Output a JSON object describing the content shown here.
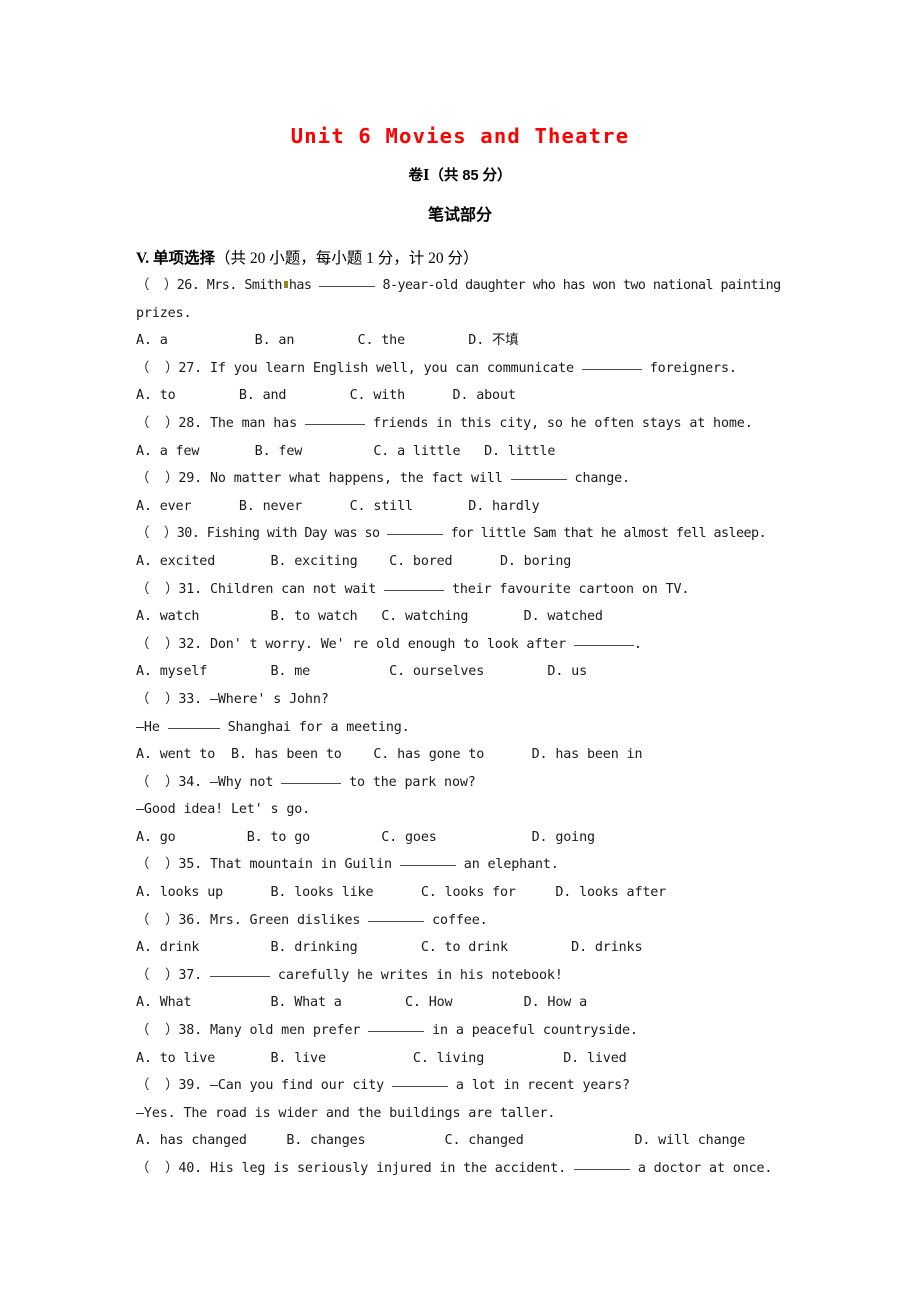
{
  "document": {
    "title": "Unit 6 Movies and Theatre",
    "volume_label": "卷",
    "volume_number": "I",
    "volume_score": "（共 85 分）",
    "section_title": "笔试部分",
    "part": {
      "roman": "V.",
      "name": "单项选择",
      "meta": "（共 20 小题，每小题 1 分，计 20 分）"
    },
    "title_color": "#ff0000",
    "text_color": "#1a1a1a"
  },
  "questions": [
    {
      "number": "26",
      "marker": "（  ）",
      "stem_1": "26. Mrs. Smith",
      "stem_2": "has",
      "stem_3": "8-year-old daughter who has won two national painting",
      "stem_wrap": "prizes.",
      "options": "A. a           B. an        C. the        D. 不填",
      "options_parts": [
        "A. a",
        "B. an",
        "C. the",
        "D. 不填"
      ]
    },
    {
      "number": "27",
      "marker": "（  ）",
      "stem": "27. If you learn English well, you can communicate",
      "stem_tail": "foreigners.",
      "options": "A. to        B. and        C. with      D. about",
      "options_parts": [
        "A. to",
        "B. and",
        "C. with",
        "D. about"
      ]
    },
    {
      "number": "28",
      "marker": "（  ）",
      "stem": "28. The man has",
      "stem_tail": "friends in this city, so he often stays at home.",
      "options": "A. a few       B. few         C. a little   D. little",
      "options_parts": [
        "A. a few",
        "B. few",
        "C. a little",
        "D. little"
      ]
    },
    {
      "number": "29",
      "marker": "（  ）",
      "stem": "29. No matter what happens, the fact will",
      "stem_tail": "change.",
      "options": "A. ever      B. never      C. still       D. hardly",
      "options_parts": [
        "A. ever",
        "B. never",
        "C. still",
        "D. hardly"
      ]
    },
    {
      "number": "30",
      "marker": "（  ）",
      "stem": "30. Fishing with Day was so",
      "stem_tail": "for little Sam that he almost fell asleep.",
      "options": "A. excited       B. exciting    C. bored      D. boring",
      "options_parts": [
        "A. excited",
        "B. exciting",
        "C. bored",
        "D. boring"
      ]
    },
    {
      "number": "31",
      "marker": "（  ）",
      "stem": "31. Children can not wait",
      "stem_tail": "their favourite cartoon on TV.",
      "options": "A. watch         B. to watch   C. watching       D. watched",
      "options_parts": [
        "A. watch",
        "B. to watch",
        "C. watching",
        "D. watched"
      ]
    },
    {
      "number": "32",
      "marker": "（  ）",
      "stem": "32. Don' t worry. We' re old enough to look after",
      "stem_tail": ".",
      "options": "A. myself        B. me          C. ourselves        D. us",
      "options_parts": [
        "A. myself",
        "B. me",
        "C. ourselves",
        "D. us"
      ]
    },
    {
      "number": "33",
      "marker": "（  ）",
      "stem": "33. —Where' s John?",
      "answer_line_pre": "—He",
      "answer_line_post": "Shanghai for a meeting.",
      "options": "A. went to  B. has been to    C. has gone to      D. has been in",
      "options_parts": [
        "A. went to",
        "B. has been to",
        "C. has gone to",
        "D. has been in"
      ]
    },
    {
      "number": "34",
      "marker": "（  ）",
      "stem": "34. —Why not",
      "stem_tail": "to the park now?",
      "answer_line": "—Good idea! Let' s go.",
      "options": "A. go         B. to go         C. goes            D. going",
      "options_parts": [
        "A. go",
        "B. to go",
        "C. goes",
        "D. going"
      ]
    },
    {
      "number": "35",
      "marker": "（  ）",
      "stem": "35. That mountain in Guilin",
      "stem_tail": "an elephant.",
      "options": "A. looks up      B. looks like      C. looks for     D. looks after",
      "options_parts": [
        "A. looks up",
        "B. looks like",
        "C. looks for",
        "D. looks after"
      ]
    },
    {
      "number": "36",
      "marker": "（  ）",
      "stem": "36. Mrs. Green dislikes",
      "stem_tail": "coffee.",
      "options": "A. drink         B. drinking        C. to drink        D. drinks",
      "options_parts": [
        "A. drink",
        "B. drinking",
        "C. to drink",
        "D. drinks"
      ]
    },
    {
      "number": "37",
      "marker": "（  ）",
      "stem_pre": "37.",
      "stem_tail": "carefully he writes in his notebook!",
      "options": "A. What          B. What a        C. How         D. How a",
      "options_parts": [
        "A. What",
        "B. What a",
        "C. How",
        "D. How a"
      ]
    },
    {
      "number": "38",
      "marker": "（  ）",
      "stem": "38. Many old men prefer",
      "stem_tail": "in a peaceful countryside.",
      "options": "A. to live       B. live           C. living          D. lived",
      "options_parts": [
        "A. to live",
        "B. live",
        "C. living",
        "D. lived"
      ]
    },
    {
      "number": "39",
      "marker": "（  ）",
      "stem": "39. —Can you find our city",
      "stem_tail": "a lot in recent years?",
      "answer_line": "—Yes. The road is wider and the buildings are taller.",
      "options": "A. has changed     B. changes          C. changed              D. will change",
      "options_parts": [
        "A. has changed",
        "B. changes",
        "C. changed",
        "D. will change"
      ]
    },
    {
      "number": "40",
      "marker": "（  ）",
      "stem": "40. His leg is seriously injured in the accident.",
      "stem_tail": "a doctor at once."
    }
  ]
}
